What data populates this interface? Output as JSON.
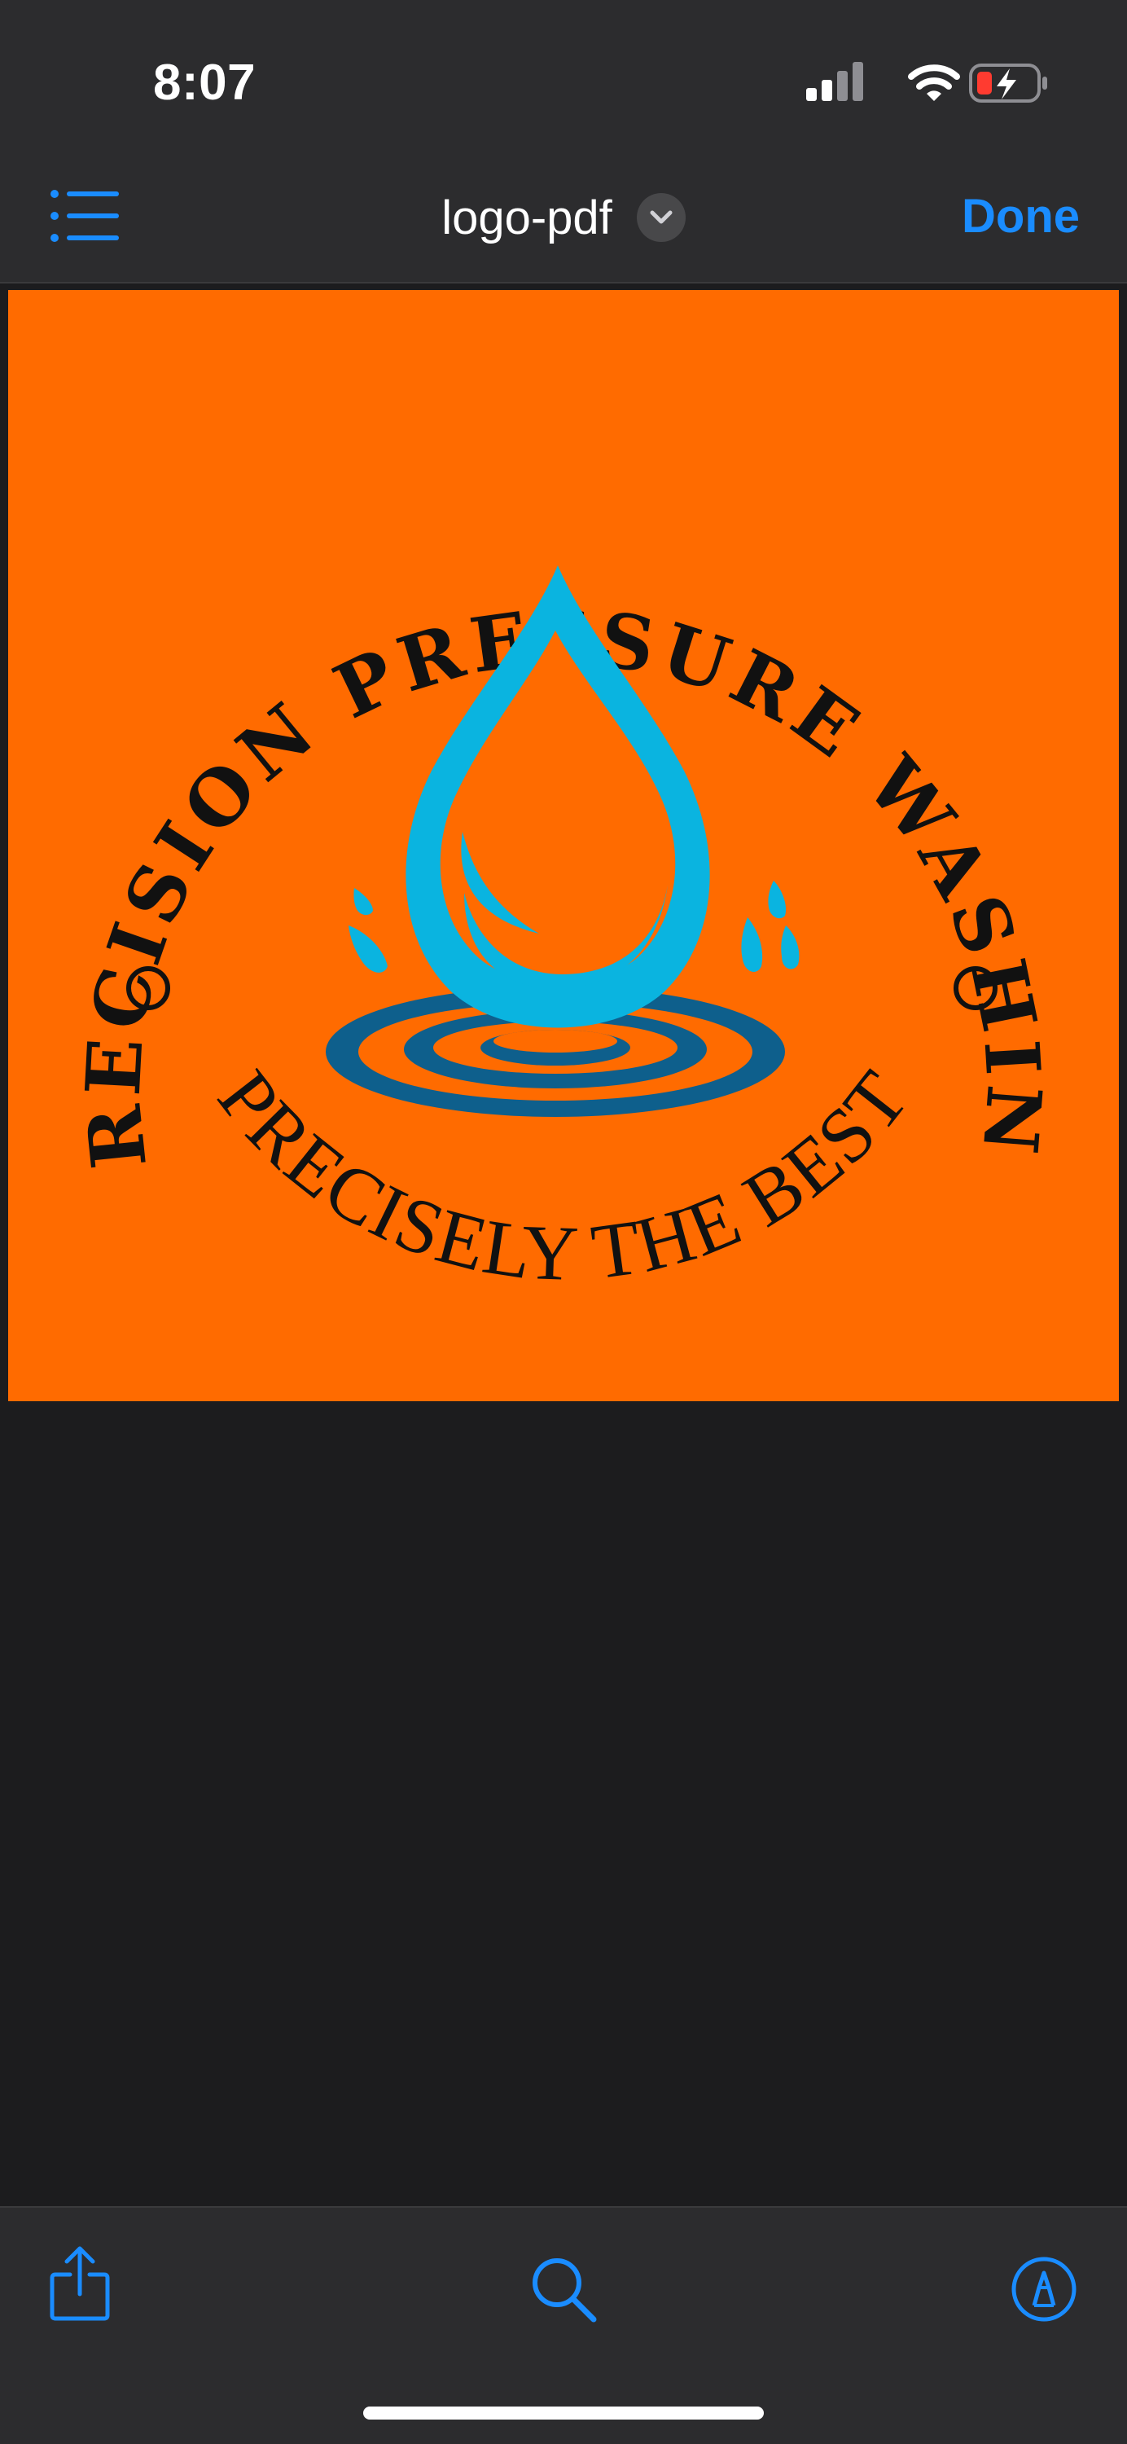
{
  "status_bar": {
    "time": "8:07",
    "icons": [
      "cellular-signal-icon",
      "wifi-icon",
      "battery-charging-icon"
    ]
  },
  "nav": {
    "title": "logo-pdf",
    "done_label": "Done",
    "icons": [
      "list-icon",
      "chevron-down-icon"
    ]
  },
  "document": {
    "logo": {
      "top_text": "PRECISION PRESSURE WASHING",
      "bottom_text": "PRECISELY THE BEST"
    }
  },
  "toolbar": {
    "icons": [
      "share-icon",
      "search-icon",
      "markup-icon"
    ]
  },
  "colors": {
    "accent": "#1a8cff",
    "bars": "#2c2c2e",
    "background": "#1c1c1e",
    "logo_background": "#ff6b00",
    "logo_drop": "#0ab4e0",
    "logo_ripple": "#0e5f8c",
    "logo_text": "#111111"
  }
}
